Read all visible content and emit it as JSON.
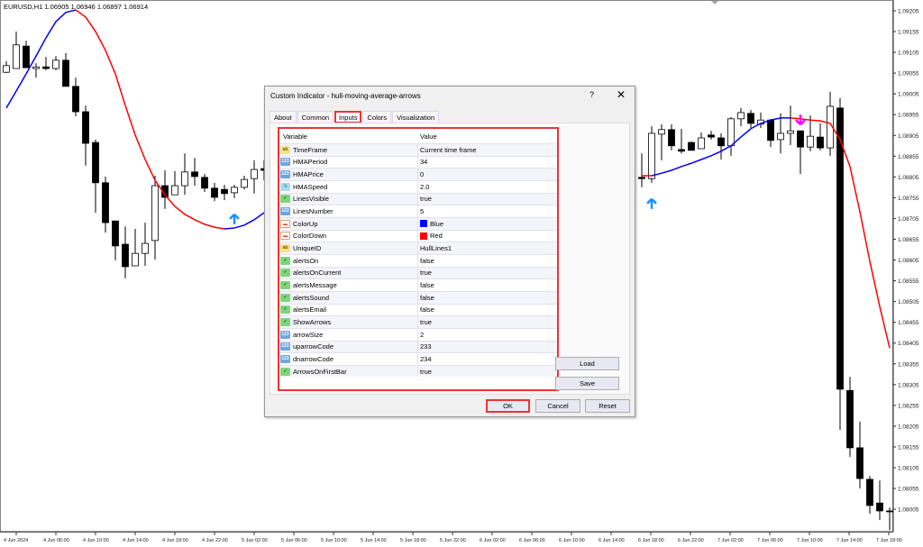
{
  "chart_header": "EURUSD,H1  1.06905 1.06946 1.06897 1.06914",
  "chart_data": {
    "type": "candlestick",
    "symbol": "EURUSD",
    "timeframe": "H1",
    "ylim": [
      1.07951,
      1.09231
    ],
    "y_ticks": [
      "1.09205",
      "1.09155",
      "1.09105",
      "1.09055",
      "1.09005",
      "1.08955",
      "1.08905",
      "1.08855",
      "1.08805",
      "1.08755",
      "1.08705",
      "1.08655",
      "1.08605",
      "1.08555",
      "1.08505",
      "1.08455",
      "1.08405",
      "1.08355",
      "1.08305",
      "1.08255",
      "1.08205",
      "1.08155",
      "1.08105",
      "1.08055",
      "1.08005"
    ],
    "x_ticks": [
      "4 Jun 2024",
      "4 Jun 06:00",
      "4 Jun 10:00",
      "4 Jun 14:00",
      "4 Jun 18:00",
      "4 Jun 22:00",
      "5 Jun 02:00",
      "5 Jun 06:00",
      "5 Jun 10:00",
      "5 Jun 14:00",
      "5 Jun 18:00",
      "5 Jun 22:00",
      "6 Jun 02:00",
      "6 Jun 06:00",
      "6 Jun 10:00",
      "6 Jun 14:00",
      "6 Jun 18:00",
      "6 Jun 22:00",
      "7 Jun 02:00",
      "7 Jun 06:00",
      "7 Jun 10:00",
      "7 Jun 14:00",
      "7 Jun 18:00"
    ],
    "colors": {
      "up": "#0000ff",
      "down": "#ff0000",
      "up_arrow": "#1e90ff",
      "down_arrow": "#ff00ff",
      "bull_body": "#ffffff",
      "bear_body": "#000000"
    },
    "segments": [
      {
        "candles_ohlc": [
          [
            1.09057,
            1.09084,
            1.09055,
            1.09073
          ],
          [
            1.09066,
            1.09155,
            1.09066,
            1.09123
          ],
          [
            1.0912,
            1.09133,
            1.09068,
            1.09068
          ],
          [
            1.09066,
            1.09079,
            1.09044,
            1.0907
          ],
          [
            1.0907,
            1.09094,
            1.09062,
            1.09066
          ],
          [
            1.09066,
            1.09096,
            1.09062,
            1.09086
          ],
          [
            1.09086,
            1.09103,
            1.09023,
            1.09023
          ],
          [
            1.09023,
            1.09044,
            1.08951,
            1.08962
          ],
          [
            1.08962,
            1.08977,
            1.08832,
            1.08886
          ],
          [
            1.08888,
            1.08895,
            1.08719,
            1.08791
          ],
          [
            1.08791,
            1.08806,
            1.08671,
            1.08695
          ],
          [
            1.08699,
            1.08699,
            1.08604,
            1.08639
          ],
          [
            1.08643,
            1.08686,
            1.08561,
            1.08589
          ],
          [
            1.08591,
            1.0868,
            1.08591,
            1.08621
          ],
          [
            1.08621,
            1.08695,
            1.08591,
            1.08645
          ],
          [
            1.08652,
            1.08808,
            1.08606,
            1.08784
          ],
          [
            1.08784,
            1.08821,
            1.08728,
            1.08756
          ],
          [
            1.08762,
            1.08819,
            1.08762,
            1.08784
          ],
          [
            1.08784,
            1.08862,
            1.08762,
            1.08817
          ],
          [
            1.08817,
            1.08851,
            1.08784,
            1.08806
          ],
          [
            1.08804,
            1.08812,
            1.08769,
            1.08778
          ],
          [
            1.08778,
            1.08791,
            1.08747,
            1.08756
          ],
          [
            1.08775,
            1.08786,
            1.08749,
            1.08765
          ],
          [
            1.08767,
            1.08786,
            1.08754,
            1.0878
          ],
          [
            1.0878,
            1.08808,
            1.08775,
            1.08799
          ],
          [
            1.08801,
            1.08845,
            1.08765,
            1.08823
          ],
          [
            1.08825,
            1.08845,
            1.08797,
            1.08821
          ]
        ],
        "hma": [
          1.08971,
          1.09012,
          1.09053,
          1.09096,
          1.0914,
          1.09179,
          1.09201,
          1.09207,
          1.0919,
          1.09155,
          1.0911,
          1.09053,
          1.08977,
          1.08906,
          1.08847,
          1.08797,
          1.08762,
          1.08734,
          1.08715,
          1.08702,
          1.08691,
          1.08684,
          1.0868,
          1.08682,
          1.08689,
          1.08702,
          1.08719
        ],
        "hma_trend": [
          {
            "from": 0,
            "to": 7,
            "dir": "up"
          },
          {
            "from": 7,
            "to": 22,
            "dir": "down"
          },
          {
            "from": 22,
            "to": 26,
            "dir": "up"
          }
        ],
        "arrows": [
          {
            "bar": 23,
            "dir": "up"
          }
        ]
      },
      {
        "candles_ohlc": [
          [
            1.08804,
            1.08862,
            1.0878,
            1.08801
          ],
          [
            1.08801,
            1.08927,
            1.08791,
            1.0891
          ],
          [
            1.08908,
            1.08932,
            1.08845,
            1.08919
          ],
          [
            1.08919,
            1.08932,
            1.08869,
            1.0888
          ],
          [
            1.08871,
            1.08921,
            1.08862,
            1.08867
          ],
          [
            1.08888,
            1.0889,
            1.08869,
            1.08869
          ],
          [
            1.08873,
            1.08912,
            1.08873,
            1.08899
          ],
          [
            1.08906,
            1.08916,
            1.08895,
            1.08901
          ],
          [
            1.08899,
            1.0891,
            1.08847,
            1.0888
          ],
          [
            1.0888,
            1.08949,
            1.08856,
            1.08945
          ],
          [
            1.08945,
            1.08971,
            1.08927,
            1.0896
          ],
          [
            1.08958,
            1.08966,
            1.08923,
            1.08934
          ],
          [
            1.08932,
            1.0896,
            1.08923,
            1.08942
          ],
          [
            1.08942,
            1.08945,
            1.08877,
            1.08893
          ],
          [
            1.08895,
            1.08958,
            1.08862,
            1.0891
          ],
          [
            1.0891,
            1.08977,
            1.08882,
            1.08916
          ],
          [
            1.08916,
            1.08916,
            1.08812,
            1.08877
          ],
          [
            1.08877,
            1.08953,
            1.08867,
            1.08903
          ],
          [
            1.08901,
            1.08934,
            1.08869,
            1.08875
          ],
          [
            1.08875,
            1.0901,
            1.08856,
            1.08975
          ],
          [
            1.08971,
            1.08995,
            1.08196,
            1.08294
          ],
          [
            1.08291,
            1.08324,
            1.08131,
            1.08153
          ],
          [
            1.08153,
            1.08216,
            1.08055,
            1.08079
          ],
          [
            1.08077,
            1.08085,
            1.07994,
            1.08014
          ],
          [
            1.0802,
            1.08074,
            1.07979,
            1.08001
          ],
          [
            1.08001,
            1.08009,
            1.07955,
            1.07999
          ]
        ],
        "hma": [
          1.08808,
          1.08808,
          1.08814,
          1.08821,
          1.0883,
          1.08838,
          1.08847,
          1.08856,
          1.08867,
          1.0888,
          1.08901,
          1.08921,
          1.08934,
          1.08942,
          1.08947,
          1.08947,
          1.08945,
          1.08942,
          1.0894,
          1.08934,
          1.08895,
          1.0883,
          1.08721,
          1.08602,
          1.08493,
          1.08393
        ],
        "hma_trend": [
          {
            "from": 0,
            "to": 1,
            "dir": "down"
          },
          {
            "from": 1,
            "to": 15,
            "dir": "up"
          },
          {
            "from": 15,
            "to": 25,
            "dir": "down"
          }
        ],
        "arrows": [
          {
            "bar": 1,
            "dir": "up"
          },
          {
            "bar": 16,
            "dir": "down"
          }
        ]
      }
    ]
  },
  "dialog": {
    "title": "Custom Indicator - hull-moving-average-arrows",
    "help": "?",
    "close": "✕",
    "tabs": [
      {
        "label": "About"
      },
      {
        "label": "Common"
      },
      {
        "label": "Inputs",
        "active": true
      },
      {
        "label": "Colors"
      },
      {
        "label": "Visualization"
      }
    ],
    "columns": {
      "variable": "Variable",
      "value": "Value"
    },
    "inputs": [
      {
        "icon": "string",
        "icon_text": "ab",
        "name": "TimeFrame",
        "value": "Current time frame"
      },
      {
        "icon": "int",
        "icon_text": "123",
        "name": "HMAPeriod",
        "value": "34"
      },
      {
        "icon": "int",
        "icon_text": "123",
        "name": "HMAPrice",
        "value": "0"
      },
      {
        "icon": "double",
        "icon_text": "½",
        "name": "HMASpeed",
        "value": "2.0"
      },
      {
        "icon": "bool",
        "icon_text": "✓",
        "name": "LinesVisible",
        "value": "true"
      },
      {
        "icon": "int",
        "icon_text": "123",
        "name": "LinesNumber",
        "value": "5"
      },
      {
        "icon": "color",
        "icon_text": "▬",
        "name": "ColorUp",
        "value": "Blue",
        "swatch": "#0000ff"
      },
      {
        "icon": "color",
        "icon_text": "▬",
        "name": "ColorDown",
        "value": "Red",
        "swatch": "#ff0000"
      },
      {
        "icon": "string",
        "icon_text": "ab",
        "name": "UniqueID",
        "value": "HullLines1"
      },
      {
        "icon": "bool",
        "icon_text": "✓",
        "name": "alertsOn",
        "value": "false"
      },
      {
        "icon": "bool",
        "icon_text": "✓",
        "name": "alertsOnCurrent",
        "value": "true"
      },
      {
        "icon": "bool",
        "icon_text": "✓",
        "name": "alertsMessage",
        "value": "false"
      },
      {
        "icon": "bool",
        "icon_text": "✓",
        "name": "alertsSound",
        "value": "false"
      },
      {
        "icon": "bool",
        "icon_text": "✓",
        "name": "alertsEmail",
        "value": "false"
      },
      {
        "icon": "bool",
        "icon_text": "✓",
        "name": "ShowArrows",
        "value": "true"
      },
      {
        "icon": "int",
        "icon_text": "123",
        "name": "arrowSize",
        "value": "2"
      },
      {
        "icon": "int",
        "icon_text": "123",
        "name": "uparrowCode",
        "value": "233"
      },
      {
        "icon": "int",
        "icon_text": "123",
        "name": "dnarrowCode",
        "value": "234"
      },
      {
        "icon": "bool",
        "icon_text": "✓",
        "name": "ArrowsOnFirstBar",
        "value": "true"
      }
    ],
    "buttons": {
      "load": "Load",
      "save": "Save",
      "ok": "OK",
      "cancel": "Cancel",
      "reset": "Reset"
    }
  }
}
